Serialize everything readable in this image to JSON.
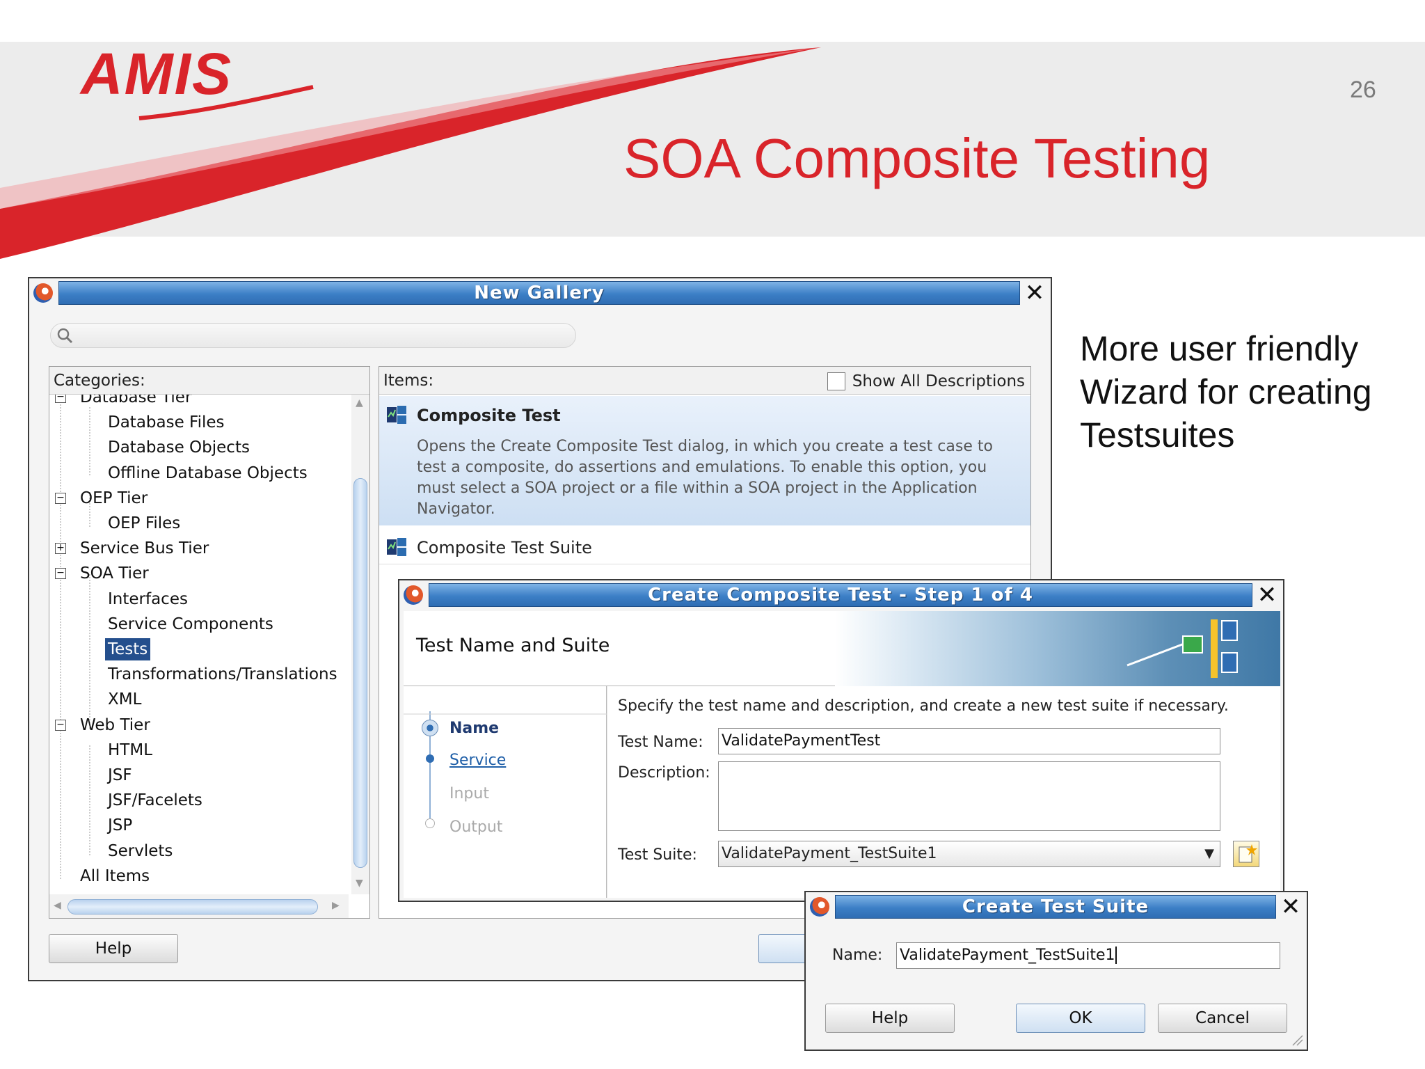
{
  "slide": {
    "logo_text": "AMIS",
    "slide_number": "26",
    "title": "SOA Composite Testing",
    "side_note_lines": [
      "More user friendly",
      "Wizard for creating",
      "Testsuites"
    ],
    "colors": {
      "brand_red": "#d9242a",
      "title_blue": "#3c7fc6"
    }
  },
  "gallery": {
    "title": "New Gallery",
    "search_icon": "search-icon",
    "categories_label": "Categories:",
    "items_label": "Items:",
    "show_all_label": "Show All Descriptions",
    "tree": [
      {
        "label": "Database Tier",
        "level": 0,
        "expander": "minus"
      },
      {
        "label": "Database Files",
        "level": 1
      },
      {
        "label": "Database Objects",
        "level": 1
      },
      {
        "label": "Offline Database Objects",
        "level": 1
      },
      {
        "label": "OEP Tier",
        "level": 0,
        "expander": "minus"
      },
      {
        "label": "OEP Files",
        "level": 1
      },
      {
        "label": "Service Bus Tier",
        "level": 0,
        "expander": "plus"
      },
      {
        "label": "SOA Tier",
        "level": 0,
        "expander": "minus"
      },
      {
        "label": "Interfaces",
        "level": 1
      },
      {
        "label": "Service Components",
        "level": 1
      },
      {
        "label": "Tests",
        "level": 1,
        "selected": true
      },
      {
        "label": "Transformations/Translations",
        "level": 1
      },
      {
        "label": "XML",
        "level": 1
      },
      {
        "label": "Web Tier",
        "level": 0,
        "expander": "minus"
      },
      {
        "label": "HTML",
        "level": 1
      },
      {
        "label": "JSF",
        "level": 1
      },
      {
        "label": "JSF/Facelets",
        "level": 1
      },
      {
        "label": "JSP",
        "level": 1
      },
      {
        "label": "Servlets",
        "level": 1
      },
      {
        "label": "All Items",
        "level": 0
      }
    ],
    "items": [
      {
        "title": "Composite Test",
        "description": "Opens the Create Composite Test dialog, in which you create a test case to test a composite, do assertions and emulations. To enable this option, you must select a SOA project or a file within a SOA project in the Application Navigator."
      },
      {
        "title": "Composite Test Suite"
      }
    ],
    "help_label": "Help"
  },
  "composite_wizard": {
    "title": "Create Composite Test - Step 1 of 4",
    "heading": "Test Name and Suite",
    "steps": [
      {
        "label": "Name",
        "state": "current"
      },
      {
        "label": "Service",
        "state": "link"
      },
      {
        "label": "Input",
        "state": "disabled"
      },
      {
        "label": "Output",
        "state": "disabled"
      }
    ],
    "instruction": "Specify the test name and description, and create a new test suite if necessary.",
    "test_name_label": "Test Name:",
    "test_name_value": "ValidatePaymentTest",
    "description_label": "Description:",
    "description_value": "",
    "test_suite_label": "Test Suite:",
    "test_suite_value": "ValidatePayment_TestSuite1"
  },
  "suite_dialog": {
    "title": "Create Test Suite",
    "name_label": "Name:",
    "name_value": "ValidatePayment_TestSuite1",
    "help_label": "Help",
    "ok_label": "OK",
    "cancel_label": "Cancel"
  }
}
